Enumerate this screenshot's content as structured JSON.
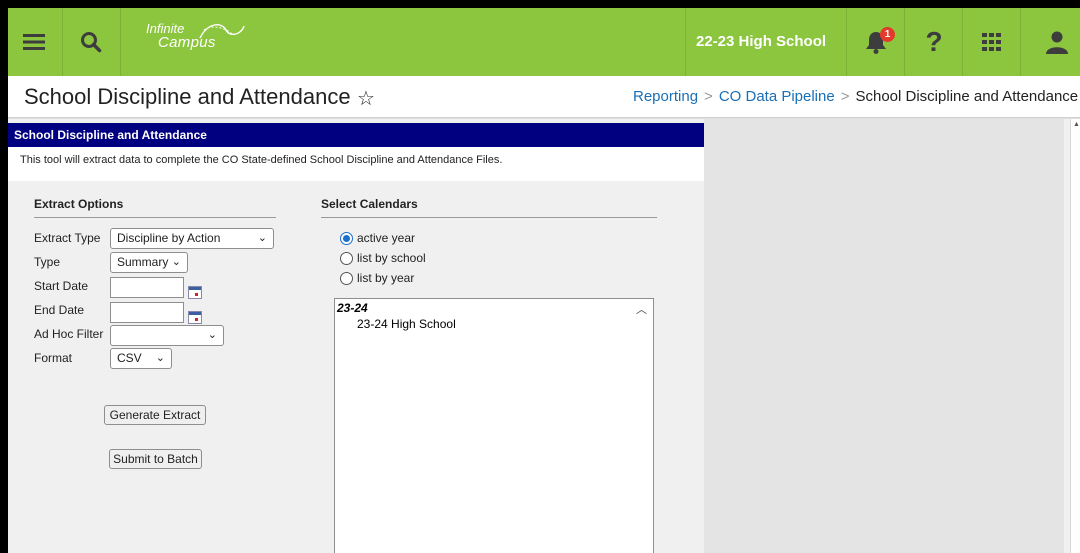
{
  "header": {
    "logo_line1": "Infinite",
    "logo_line2": "Campus",
    "school": "22-23 High School",
    "notification_count": "1",
    "help_glyph": "?",
    "icons": [
      "menu-icon",
      "search-icon",
      "bell-icon",
      "help-icon",
      "apps-grid-icon",
      "user-icon"
    ],
    "color": "#8cc63e"
  },
  "page": {
    "title": "School Discipline and Attendance",
    "favorite_glyph": "☆",
    "breadcrumb": [
      "Reporting",
      "CO Data Pipeline",
      "School Discipline and Attendance"
    ],
    "breadcrumb_sep": ">"
  },
  "tool": {
    "header": "School Discipline and Attendance",
    "description": "This tool will extract data to complete the CO State-defined School Discipline and Attendance Files.",
    "header_color": "#000080"
  },
  "extract_options": {
    "title": "Extract Options",
    "extract_type_label": "Extract Type",
    "extract_type_value": "Discipline by Action",
    "type_label": "Type",
    "type_value": "Summary",
    "start_date_label": "Start Date",
    "start_date_value": "",
    "end_date_label": "End Date",
    "end_date_value": "",
    "ad_hoc_label": "Ad Hoc Filter",
    "ad_hoc_value": "",
    "format_label": "Format",
    "format_value": "CSV",
    "generate_button": "Generate Extract",
    "batch_button": "Submit to Batch"
  },
  "calendars": {
    "title": "Select Calendars",
    "radio_options": [
      "active year",
      "list by school",
      "list by year"
    ],
    "selected_index": 0,
    "list_year": "23-24",
    "list_item": "23-24 High School"
  }
}
